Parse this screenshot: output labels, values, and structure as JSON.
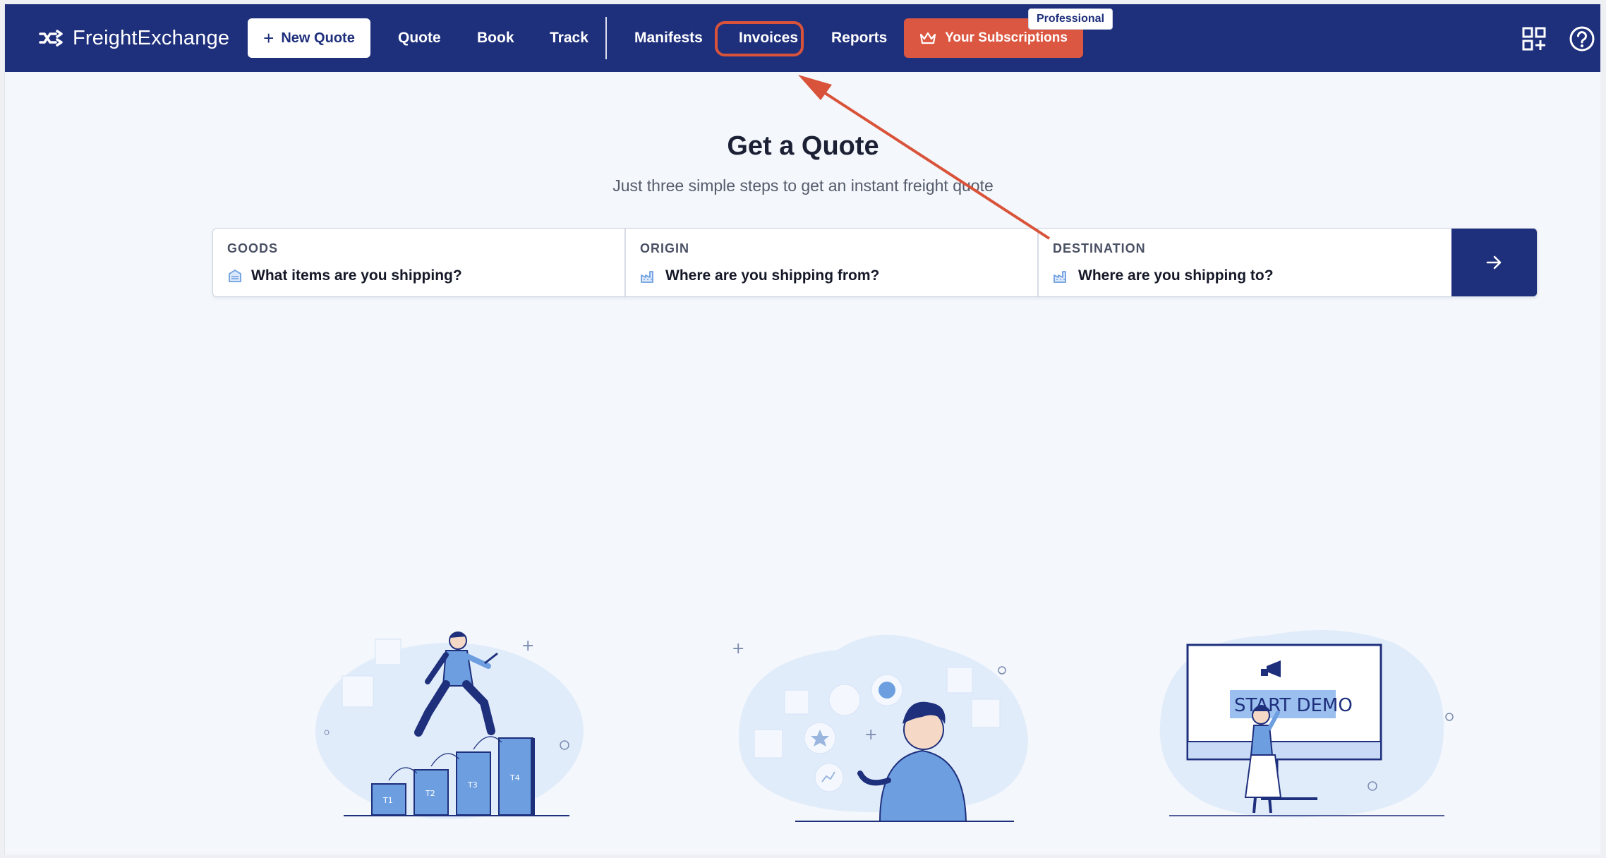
{
  "nav": {
    "logo_text": "FreightExchange",
    "new_quote": "New Quote",
    "links": [
      "Quote",
      "Book",
      "Track",
      "Manifests",
      "Invoices",
      "Reports"
    ],
    "subscriptions": "Your Subscriptions",
    "plan_badge": "Professional",
    "icons": [
      "apps-grid-icon",
      "help-icon"
    ]
  },
  "hero": {
    "title": "Get a Quote",
    "subtitle": "Just three simple steps to get an instant freight quote"
  },
  "quote_form": {
    "fields": [
      {
        "label": "GOODS",
        "placeholder": "What items are you shipping?",
        "icon": "box-icon"
      },
      {
        "label": "ORIGIN",
        "placeholder": "Where are you shipping from?",
        "icon": "factory-icon"
      },
      {
        "label": "DESTINATION",
        "placeholder": "Where are you shipping to?",
        "icon": "factory-icon"
      }
    ],
    "submit_icon": "arrow-right-icon"
  },
  "illustrations": {
    "step_bars": [
      "T1",
      "T2",
      "T3",
      "T4"
    ],
    "demo_label": "START DEMO"
  },
  "colors": {
    "navbar": "#1e2f7c",
    "accent": "#dc5741",
    "highlight": "#d9533a",
    "illustration": "#6d9fe0"
  }
}
